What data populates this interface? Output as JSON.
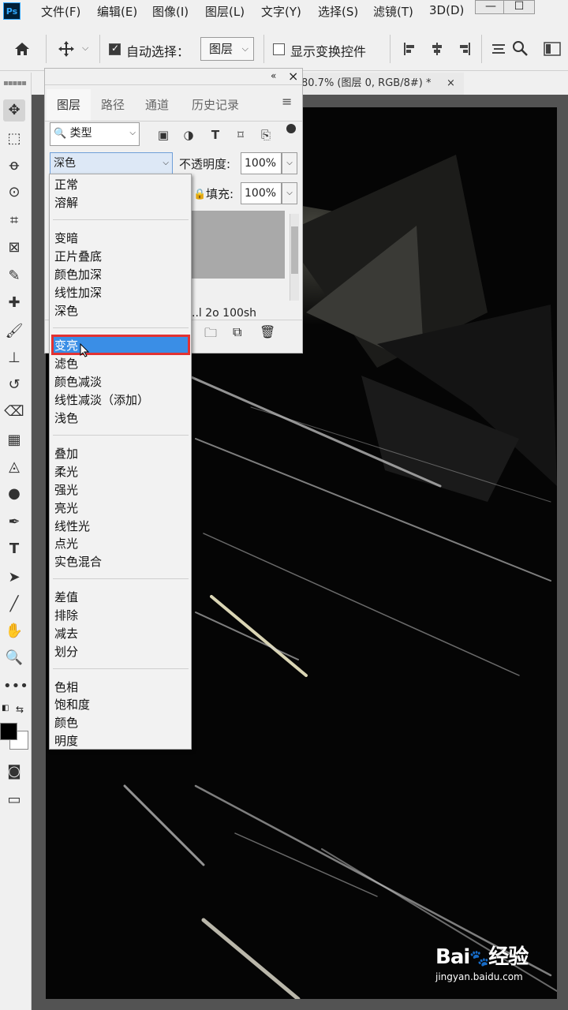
{
  "app": {
    "logo_text": "Ps"
  },
  "menubar": {
    "items": [
      "文件(F)",
      "编辑(E)",
      "图像(I)",
      "图层(L)",
      "文字(Y)",
      "选择(S)",
      "滤镜(T)",
      "3D(D)"
    ],
    "window_buttons": [
      "—",
      "☐"
    ]
  },
  "options": {
    "auto_select_label": "自动选择：",
    "auto_select_checked": true,
    "auto_select_target": "图层",
    "show_transform_label": "显示变换控件",
    "show_transform_checked": false
  },
  "document": {
    "tab_title": "80.7% (图层 0, RGB/8#) *",
    "close": "×"
  },
  "layers_panel": {
    "collapse_icon": "«",
    "close_icon": "×",
    "tabs": [
      "图层",
      "路径",
      "通道",
      "历史记录"
    ],
    "active_tab": "图层",
    "filter_label": "类型",
    "blend_mode_value": "深色",
    "opacity_label": "不透明度:",
    "opacity_value": "100%",
    "fill_label": "填充:",
    "fill_value": "100%",
    "layer_info_text": "..l 2o 100sh"
  },
  "blend_modes": {
    "groups": [
      [
        "正常",
        "溶解"
      ],
      [
        "变暗",
        "正片叠底",
        "颜色加深",
        "线性加深",
        "深色"
      ],
      [
        "变亮",
        "滤色",
        "颜色减淡",
        "线性减淡（添加）",
        "浅色"
      ],
      [
        "叠加",
        "柔光",
        "强光",
        "亮光",
        "线性光",
        "点光",
        "实色混合"
      ],
      [
        "差值",
        "排除",
        "减去",
        "划分"
      ],
      [
        "色相",
        "饱和度",
        "颜色",
        "明度"
      ]
    ],
    "highlighted": "变亮"
  },
  "watermark": {
    "brand": "Bai",
    "brand2": "经验",
    "url": "jingyan.baidu.com"
  },
  "colors": {
    "highlight": "#3a8ee6",
    "highlight_border": "#e23232",
    "canvas": "#050505"
  }
}
